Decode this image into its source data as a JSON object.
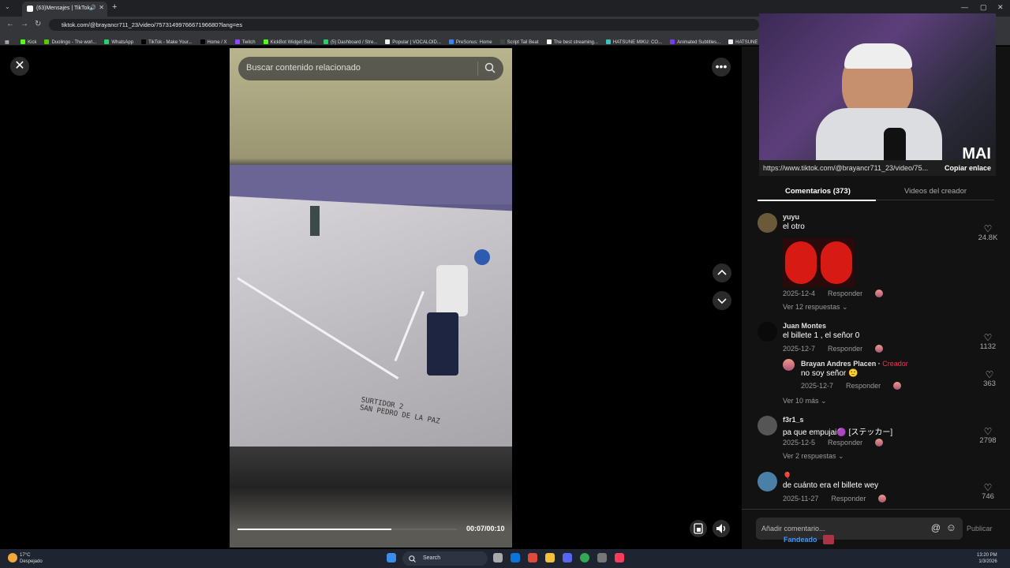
{
  "browser": {
    "tab_title": "(63)Mensajes | TikTok",
    "url": "tiktok.com/@brayancr711_23/video/7573149976667196680?lang=es",
    "bookmarks": [
      {
        "label": "Kick",
        "color": "#53fc18"
      },
      {
        "label": "Duolingo - The worl...",
        "color": "#58cc02"
      },
      {
        "label": "WhatsApp",
        "color": "#25d366"
      },
      {
        "label": "TikTok - Make Your...",
        "color": "#000000"
      },
      {
        "label": "Home / X",
        "color": "#000000"
      },
      {
        "label": "Twitch",
        "color": "#9146ff"
      },
      {
        "label": "KickBot Widget Buil...",
        "color": "#53fc18"
      },
      {
        "label": "(5) Dashboard / Stre...",
        "color": "#2ecc71"
      },
      {
        "label": "Popular | VOCALOID...",
        "color": "#eeeeee"
      },
      {
        "label": "PreSonus: Home",
        "color": "#3b82f6"
      },
      {
        "label": "Script Tail Beat",
        "color": "#444444"
      },
      {
        "label": "The best streaming...",
        "color": "#ffffff"
      },
      {
        "label": "HATSUNE MIKU: CO...",
        "color": "#39c5bb"
      },
      {
        "label": "Animated Subtitles...",
        "color": "#7c3aed"
      },
      {
        "label": "HATSUNE MIKU",
        "color": "#eeeeee"
      }
    ]
  },
  "player": {
    "search_placeholder": "Buscar contenido relacionado",
    "time": "00:07/00:10",
    "progress_fraction": 0.7,
    "overlay_text_1": "SURTIDOR 2",
    "overlay_text_2": "SAN PEDRO DE LA PAZ"
  },
  "webcam": {
    "logo_text": "MAI",
    "share_url": "https://www.tiktok.com/@brayancr711_23/video/75...",
    "copy_label": "Copiar enlace"
  },
  "panel": {
    "tab_comments": "Comentarios (373)",
    "tab_creator_videos": "Videos del creador",
    "reply_label": "Responder",
    "comments": [
      {
        "user": "yuyu",
        "text": "el otro",
        "date": "2025-12-4",
        "likes": "24.8K",
        "replies": "Ver 12 respuestas",
        "avatar_color": "#6b5a3a"
      },
      {
        "user": "Juan Montes",
        "text": "el billete 1 , el señor 0",
        "date": "2025-12-7",
        "likes": "1132",
        "replies": "Ver 10 más",
        "avatar_color": "#0a0a0a"
      },
      {
        "user": "f3r1_s",
        "text": "pa que empujai🟣 [ステッカー]",
        "date": "2025-12-5",
        "likes": "2798",
        "replies": "Ver 2 respuestas",
        "avatar_color": "#555555"
      },
      {
        "user": "🎈",
        "text": "de cuánto era el billete wey",
        "date": "2025-11-27",
        "likes": "746",
        "replies": "",
        "avatar_color": "#4a7fa8"
      }
    ],
    "reply": {
      "user": "Brayan Andres Placen",
      "badge": "Creador",
      "text": "no soy señor 🙂",
      "date": "2025-12-7",
      "likes": "363"
    },
    "comment_placeholder": "Añadir comentario...",
    "publish_label": "Publicar",
    "fandeado_label": "Fandeado"
  },
  "taskbar": {
    "temp": "17°C",
    "weather": "Despejado",
    "search_label": "Search",
    "time": "13:20 PM",
    "date": "1/3/2026"
  }
}
